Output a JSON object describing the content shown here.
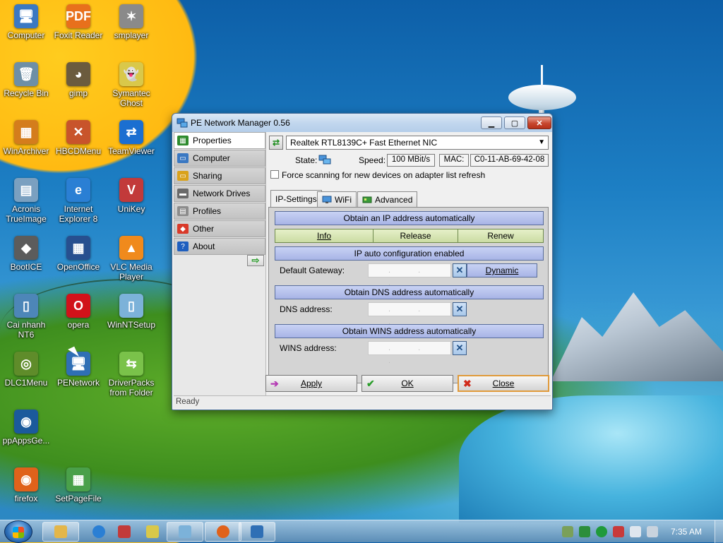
{
  "desktop": {
    "icons": [
      {
        "label": "Computer",
        "glyph": "🖥",
        "color": "#3b78c2"
      },
      {
        "label": "Foxit Reader",
        "glyph": "PDF",
        "color": "#e8701c"
      },
      {
        "label": "smplayer",
        "glyph": "✶",
        "color": "#8a8a8a"
      },
      {
        "label": "Recycle Bin",
        "glyph": "🗑",
        "color": "#6e8fa6"
      },
      {
        "label": "gimp",
        "glyph": "◕",
        "color": "#6b5b3e"
      },
      {
        "label": "Symantec Ghost",
        "glyph": "👻",
        "color": "#d9c84a"
      },
      {
        "label": "WinArchiver",
        "glyph": "▦",
        "color": "#d47d1c"
      },
      {
        "label": "HBCDMenu",
        "glyph": "✕",
        "color": "#c8542b"
      },
      {
        "label": "TeamViewer",
        "glyph": "⇄",
        "color": "#1b6fd1"
      },
      {
        "label": "Acronis TrueImage",
        "glyph": "▤",
        "color": "#7aa0c0"
      },
      {
        "label": "Internet Explorer 8",
        "glyph": "e",
        "color": "#2a7fd4"
      },
      {
        "label": "UniKey",
        "glyph": "V",
        "color": "#c23a3a"
      },
      {
        "label": "BootICE",
        "glyph": "◆",
        "color": "#5c5c5c"
      },
      {
        "label": "OpenOffice",
        "glyph": "▦",
        "color": "#274f8f"
      },
      {
        "label": "VLC Media Player",
        "glyph": "▲",
        "color": "#f08a1c"
      },
      {
        "label": "Cai nhanh NT6",
        "glyph": "▯",
        "color": "#4d86b8"
      },
      {
        "label": "opera",
        "glyph": "O",
        "color": "#d1121a"
      },
      {
        "label": "WinNTSetup",
        "glyph": "▯",
        "color": "#7cb2d9"
      },
      {
        "label": "DLC1Menu",
        "glyph": "◎",
        "color": "#5f8c2a"
      },
      {
        "label": "PENetwork",
        "glyph": "🖥",
        "color": "#2f6fb5"
      },
      {
        "label": "DriverPacks from Folder",
        "glyph": "⇆",
        "color": "#7ac24a"
      },
      {
        "label": "ppAppsGe...",
        "glyph": "◉",
        "color": "#1b5a9c"
      },
      {
        "label": "firefox",
        "glyph": "◉",
        "color": "#e0621b"
      },
      {
        "label": "SetPageFile",
        "glyph": "▦",
        "color": "#4aa04a"
      }
    ]
  },
  "window": {
    "title": "PE Network Manager 0.56",
    "nav": [
      {
        "label": "Properties",
        "color": "#2e8b2e",
        "glyph": "▦"
      },
      {
        "label": "Computer",
        "color": "#3a78c2",
        "glyph": "▭"
      },
      {
        "label": "Sharing",
        "color": "#d9a21c",
        "glyph": "▭"
      },
      {
        "label": "Network Drives",
        "color": "#6a6a6a",
        "glyph": "▬"
      },
      {
        "label": "Profiles",
        "color": "#8c8c8c",
        "glyph": "▤"
      },
      {
        "label": "Other",
        "color": "#d93a2a",
        "glyph": "◆"
      },
      {
        "label": "About",
        "color": "#1f5fbf",
        "glyph": "?"
      }
    ],
    "adapter": {
      "selected": "Realtek RTL8139C+ Fast Ethernet NIC",
      "state_label": "State:",
      "speed_label": "Speed:",
      "speed_value": "100 MBit/s",
      "mac_label": "MAC:",
      "mac_value": "C0-11-AB-69-42-08",
      "force_scan_label": "Force scanning for new devices on adapter list refresh"
    },
    "tabs": [
      {
        "label": "IP-Settings"
      },
      {
        "label": "WiFi"
      },
      {
        "label": "Advanced"
      }
    ],
    "ip": {
      "obtain_ip": "Obtain an IP address automatically",
      "info": "Info",
      "release": "Release",
      "renew": "Renew",
      "auto_config": "IP auto configuration enabled",
      "gateway_label": "Default Gateway:",
      "dynamic": "Dynamic",
      "obtain_dns": "Obtain DNS address automatically",
      "dns_label": "DNS address:",
      "obtain_wins": "Obtain WINS address automatically",
      "wins_label": "WINS address:",
      "ip_placeholder": ". . ."
    },
    "buttons": {
      "apply": "Apply",
      "ok": "OK",
      "close": "Close"
    },
    "status": "Ready"
  },
  "taskbar": {
    "clock": "7:35 AM"
  },
  "colors": {
    "band": "#b4bfee",
    "action_green": "#d8e6b6",
    "close_highlight": "#e09a3a"
  }
}
